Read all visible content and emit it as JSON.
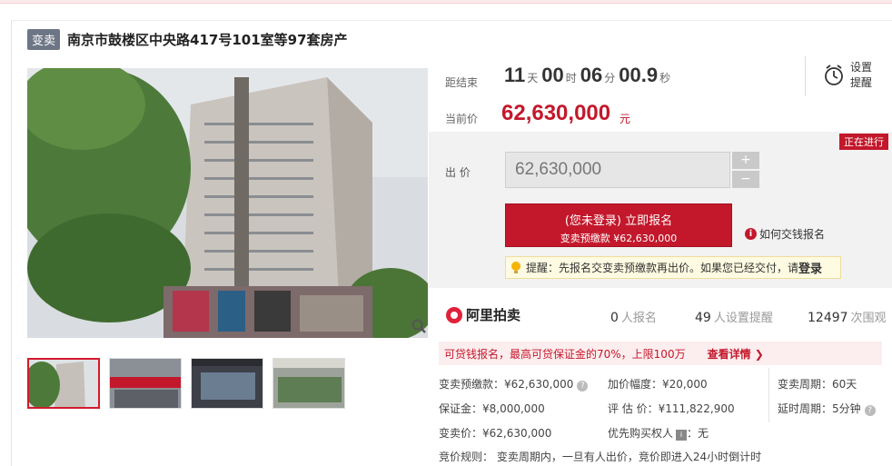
{
  "header": {
    "tag": "变卖",
    "title": "南京市鼓楼区中央路417号101室等97套房产"
  },
  "countdown": {
    "label": "距结束",
    "days": "11",
    "days_unit": "天",
    "hours": "00",
    "hours_unit": "时",
    "minutes": "06",
    "minutes_unit": "分",
    "seconds": "00.9",
    "seconds_unit": "秒"
  },
  "current_price": {
    "label": "当前价",
    "value": "62,630,000",
    "unit": "元"
  },
  "reminder": {
    "line1": "设置",
    "line2": "提醒"
  },
  "status_badge": "正在进行",
  "bid": {
    "label": "出 价",
    "value": "62,630,000",
    "plus": "+",
    "minus": "−"
  },
  "signup": {
    "line1": "(您未登录) 立即报名",
    "line2": "变卖预缴款 ¥62,630,000"
  },
  "howto": "如何交钱报名",
  "tip": {
    "text": "提醒：先报名交变卖预缴款再出价。如果您已经交付，请",
    "login": "登录"
  },
  "brand": {
    "name": "阿里拍卖"
  },
  "stats": {
    "signup_count": "0",
    "signup_label": "人报名",
    "remind_count": "49",
    "remind_label": "人设置提醒",
    "view_count": "12497",
    "view_label": "次围观"
  },
  "loan": {
    "text": "可贷钱报名，最高可贷保证金的70%，上限100万",
    "detail": "查看详情 ❯"
  },
  "details": {
    "deposit": "变卖预缴款：¥62,630,000",
    "increment": "加价幅度：¥20,000",
    "period": "变卖周期：60天",
    "margin": "保证金：¥8,000,000",
    "appraisal": "评 估 价：¥111,822,900",
    "extension": "延时周期：5分钟",
    "sale_price": "变卖价：¥62,630,000",
    "priority": "优先购买权人",
    "priority_value": "：无"
  },
  "rule": "竞价规则： 变卖周期内，一旦有人出价，竞价即进入24小时倒计时"
}
